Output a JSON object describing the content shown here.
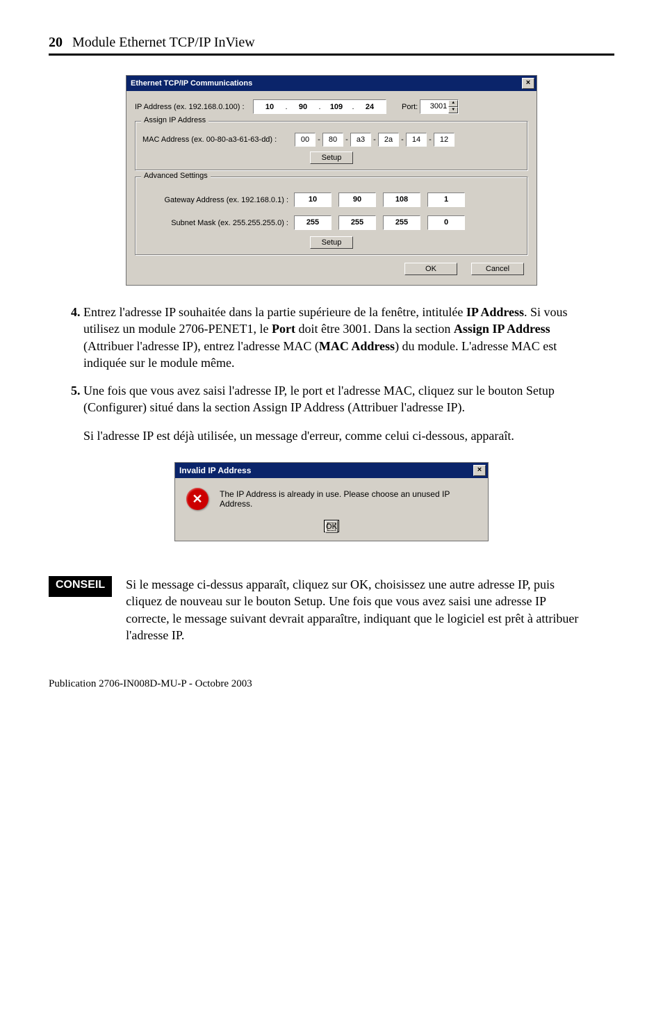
{
  "header": {
    "page_number": "20",
    "title": "Module Ethernet TCP/IP InView"
  },
  "dialog1": {
    "title": "Ethernet TCP/IP Communications",
    "ip_label": "IP Address (ex. 192.168.0.100) :",
    "ip_segments": [
      "10",
      "90",
      "109",
      "24"
    ],
    "port_label": "Port:",
    "port_value": "3001",
    "assign_group": {
      "legend": "Assign IP Address",
      "mac_label": "MAC Address (ex. 00-80-a3-61-63-dd) :",
      "mac_segments": [
        "00",
        "80",
        "a3",
        "2a",
        "14",
        "12"
      ],
      "setup_label": "Setup"
    },
    "advanced_group": {
      "legend": "Advanced Settings",
      "gateway_label": "Gateway Address (ex. 192.168.0.1) :",
      "gateway_segments": [
        "10",
        "90",
        "108",
        "1"
      ],
      "subnet_label": "Subnet Mask (ex. 255.255.255.0) :",
      "subnet_segments": [
        "255",
        "255",
        "255",
        "0"
      ],
      "setup_label": "Setup"
    },
    "ok_label": "OK",
    "cancel_label": "Cancel"
  },
  "list": {
    "item4": "Entrez l'adresse IP souhaitée dans la partie supérieure de la fenêtre, intitulée IP Address. Si vous utilisez un module 2706-PENET1, le Port doit être 3001. Dans la section Assign IP Address (Attribuer l'adresse IP), entrez l'adresse MAC (MAC Address) du module. L'adresse MAC est indiquée sur le module même.",
    "item5": "Une fois que vous avez saisi l'adresse IP, le port et l'adresse MAC, cliquez sur le bouton Setup (Configurer) situé dans la section Assign IP Address (Attribuer l'adresse IP).",
    "followup": "Si l'adresse IP est déjà utilisée, un message d'erreur, comme celui ci-dessous, apparaît."
  },
  "dialog2": {
    "title": "Invalid IP Address",
    "message": "The IP Address is already in use.  Please choose an unused IP Address.",
    "ok_label": "OK"
  },
  "tip": {
    "badge": "CONSEIL",
    "text": "Si le message ci-dessus apparaît, cliquez sur OK, choisissez une autre adresse IP, puis cliquez de nouveau sur le bouton Setup. Une fois que vous avez saisi une adresse IP correcte, le message suivant devrait apparaître, indiquant que le logiciel est prêt à attribuer l'adresse IP."
  },
  "footer": "Publication 2706-IN008D-MU-P - Octobre 2003"
}
